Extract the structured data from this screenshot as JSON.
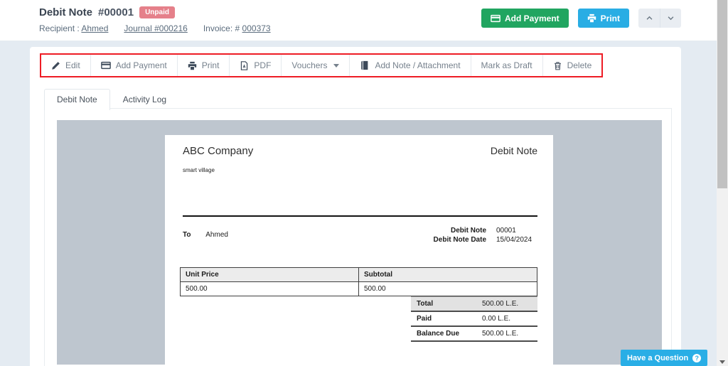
{
  "header": {
    "title": "Debit Note",
    "doc_number": "#00001",
    "status_badge": "Unpaid",
    "recipient_label": "Recipient :",
    "recipient_name": "Ahmed",
    "journal_link": "Journal #000216",
    "invoice_label": "Invoice: #",
    "invoice_number": "000373",
    "buttons": {
      "add_payment": "Add Payment",
      "print": "Print"
    }
  },
  "toolbar": {
    "items": [
      {
        "label": "Edit",
        "icon": "pencil-icon"
      },
      {
        "label": "Add Payment",
        "icon": "credit-card-icon"
      },
      {
        "label": "Print",
        "icon": "printer-icon"
      },
      {
        "label": "PDF",
        "icon": "file-pdf-icon"
      },
      {
        "label": "Vouchers",
        "icon": "caret-down-icon"
      },
      {
        "label": "Add Note / Attachment",
        "icon": "book-icon"
      },
      {
        "label": "Mark as Draft",
        "icon": null
      },
      {
        "label": "Delete",
        "icon": "trash-icon"
      }
    ]
  },
  "tabs": [
    {
      "label": "Debit Note",
      "active": true
    },
    {
      "label": "Activity Log",
      "active": false
    }
  ],
  "document": {
    "company_name": "ABC Company",
    "company_address": "smart village",
    "doc_type": "Debit Note",
    "to_label": "To",
    "to_name": "Ahmed",
    "meta": [
      {
        "label": "Debit Note",
        "value": "00001"
      },
      {
        "label": "Debit Note Date",
        "value": "15/04/2024"
      }
    ],
    "items_table": {
      "headers": [
        "Unit Price",
        "Subtotal"
      ],
      "rows": [
        [
          "500.00",
          "500.00"
        ]
      ]
    },
    "totals": [
      {
        "label": "Total",
        "value": "500.00 L.E."
      },
      {
        "label": "Paid",
        "value": "0.00 L.E."
      },
      {
        "label": "Balance Due",
        "value": "500.00 L.E."
      }
    ]
  },
  "help": {
    "label": "Have a Question",
    "icon_glyph": "?"
  },
  "colors": {
    "primary_green": "#21a560",
    "info_blue": "#29ade4",
    "badge_pink": "#e5808a",
    "annotation_red": "#ee1c25",
    "preview_gray": "#bec6cf",
    "page_bg": "#e4ebf2"
  }
}
